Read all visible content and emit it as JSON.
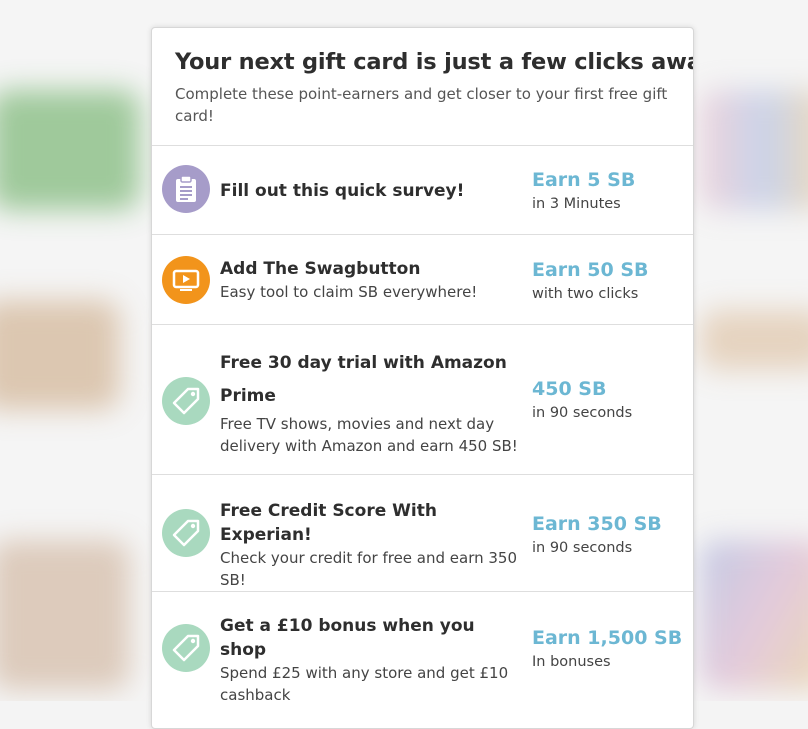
{
  "modal": {
    "title": "Your next gift card is just a few clicks away!",
    "subtitle": "Complete these point-earners and get closer to your first free gift card!"
  },
  "offers": [
    {
      "title": "Fill out this quick survey!",
      "description": "",
      "reward": "Earn 5 SB",
      "timing": "in 3 Minutes",
      "icon": "clipboard-icon",
      "icon_color": "#a69cc9"
    },
    {
      "title": "Add The Swagbutton",
      "description": "Easy tool to claim SB everywhere!",
      "reward": "Earn 50 SB",
      "timing": "with two clicks",
      "icon": "video-screen-icon",
      "icon_color": "#f2941b"
    },
    {
      "title": "Free 30 day trial with Amazon Prime",
      "description": "Free TV shows, movies and next day delivery with Amazon and earn 450 SB!",
      "reward": "450 SB",
      "timing": "in 90 seconds",
      "icon": "tag-icon",
      "icon_color": "#a9d9bf"
    },
    {
      "title": "Free Credit Score With Experian!",
      "description": "Check your credit for free and earn 350 SB!",
      "reward": "Earn 350 SB",
      "timing": "in 90 seconds",
      "icon": "tag-icon",
      "icon_color": "#a9d9bf"
    },
    {
      "title": "Get a £10 bonus when you shop",
      "description": "Spend £25 with any store and get £10 cashback",
      "reward": "Earn 1,500 SB",
      "timing": "In bonuses",
      "icon": "tag-icon",
      "icon_color": "#a9d9bf"
    }
  ],
  "colors": {
    "reward": "#6cb7d3",
    "survey_icon_bg": "#a69cc9",
    "swagbutton_icon_bg": "#f2941b",
    "tag_icon_bg": "#a9d9bf"
  }
}
